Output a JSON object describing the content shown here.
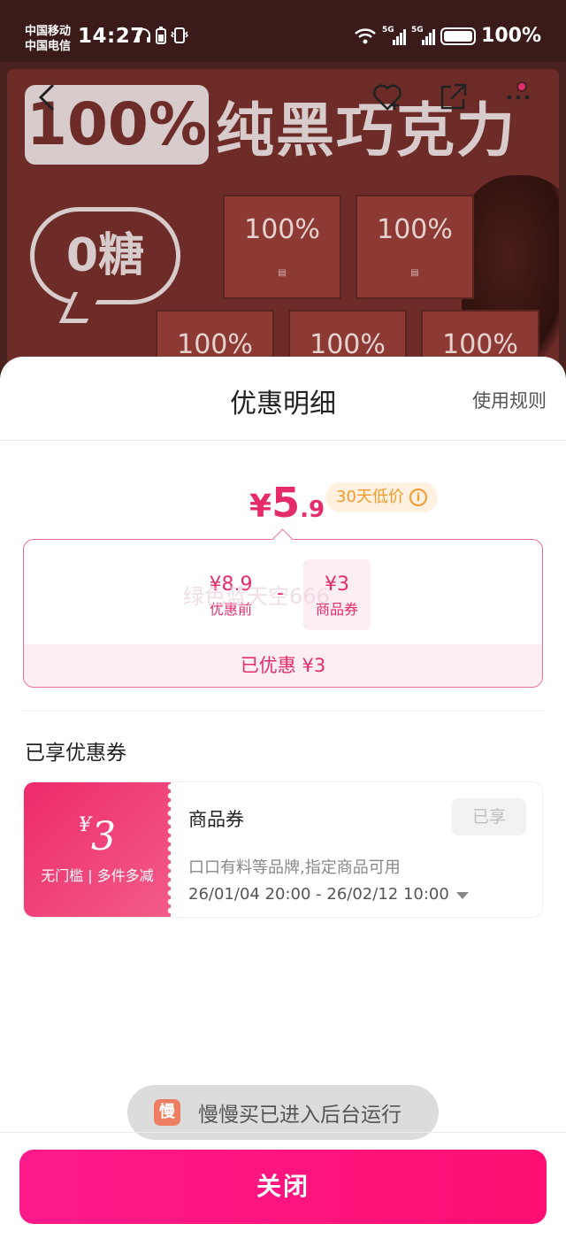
{
  "status_bar": {
    "carrier_1": "中国移动",
    "carrier_2": "中国电信",
    "time": "14:27",
    "network_1": "5G",
    "network_2": "5G",
    "battery": "100%"
  },
  "hero": {
    "tag": "100%",
    "title": "纯黑巧克力",
    "sugar_badge": "0糖",
    "box_label": "100%",
    "icons": [
      "back-icon",
      "favorite-add-icon",
      "share-icon",
      "more-icon"
    ]
  },
  "sheet": {
    "title": "优惠明细",
    "rules_link": "使用规则",
    "final_price": {
      "symbol": "¥",
      "integer": "5",
      "decimal": ".9"
    },
    "lowest_badge": "30天低价",
    "calc": {
      "before_value": "¥8.9",
      "before_label": "优惠前",
      "operator": "-",
      "coupon_value": "¥3",
      "coupon_label": "商品券",
      "watermark": "绿色蓝天空666",
      "saved": "已优惠 ¥3"
    },
    "section_title": "已享优惠券",
    "coupon": {
      "symbol": "¥",
      "amount": "3",
      "condition": "无门槛 | 多件多减",
      "name": "商品券",
      "status_button": "已享",
      "scope": "口口有料等品牌,指定商品可用",
      "validity": "26/01/04 20:00 - 26/02/12 10:00"
    }
  },
  "toast": {
    "icon_char": "慢",
    "text": "慢慢买已进入后台运行"
  },
  "close_button": "关闭",
  "colors": {
    "accent": "#e62b6b",
    "button": "#ff1480",
    "badge_text": "#f39a2b"
  }
}
